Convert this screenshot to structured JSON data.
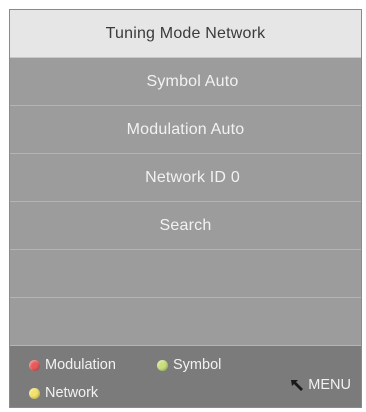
{
  "menu": {
    "title": "Tuning Mode Network",
    "items": [
      {
        "label": "Symbol Auto"
      },
      {
        "label": "Modulation Auto"
      },
      {
        "label": "Network ID 0"
      },
      {
        "label": "Search"
      },
      {
        "label": ""
      },
      {
        "label": ""
      }
    ]
  },
  "footer": {
    "legend": [
      {
        "label": "Modulation",
        "color": "#e85a5a"
      },
      {
        "label": "Symbol",
        "color": "#c9e07a"
      },
      {
        "label": "Network",
        "color": "#f2e16a"
      }
    ],
    "menu_label": "MENU",
    "menu_icon": "return-arrow-icon"
  },
  "colors": {
    "panel": "#9c9c9c",
    "title_bar": "#e6e6e6",
    "footer": "#7b7b7b"
  }
}
